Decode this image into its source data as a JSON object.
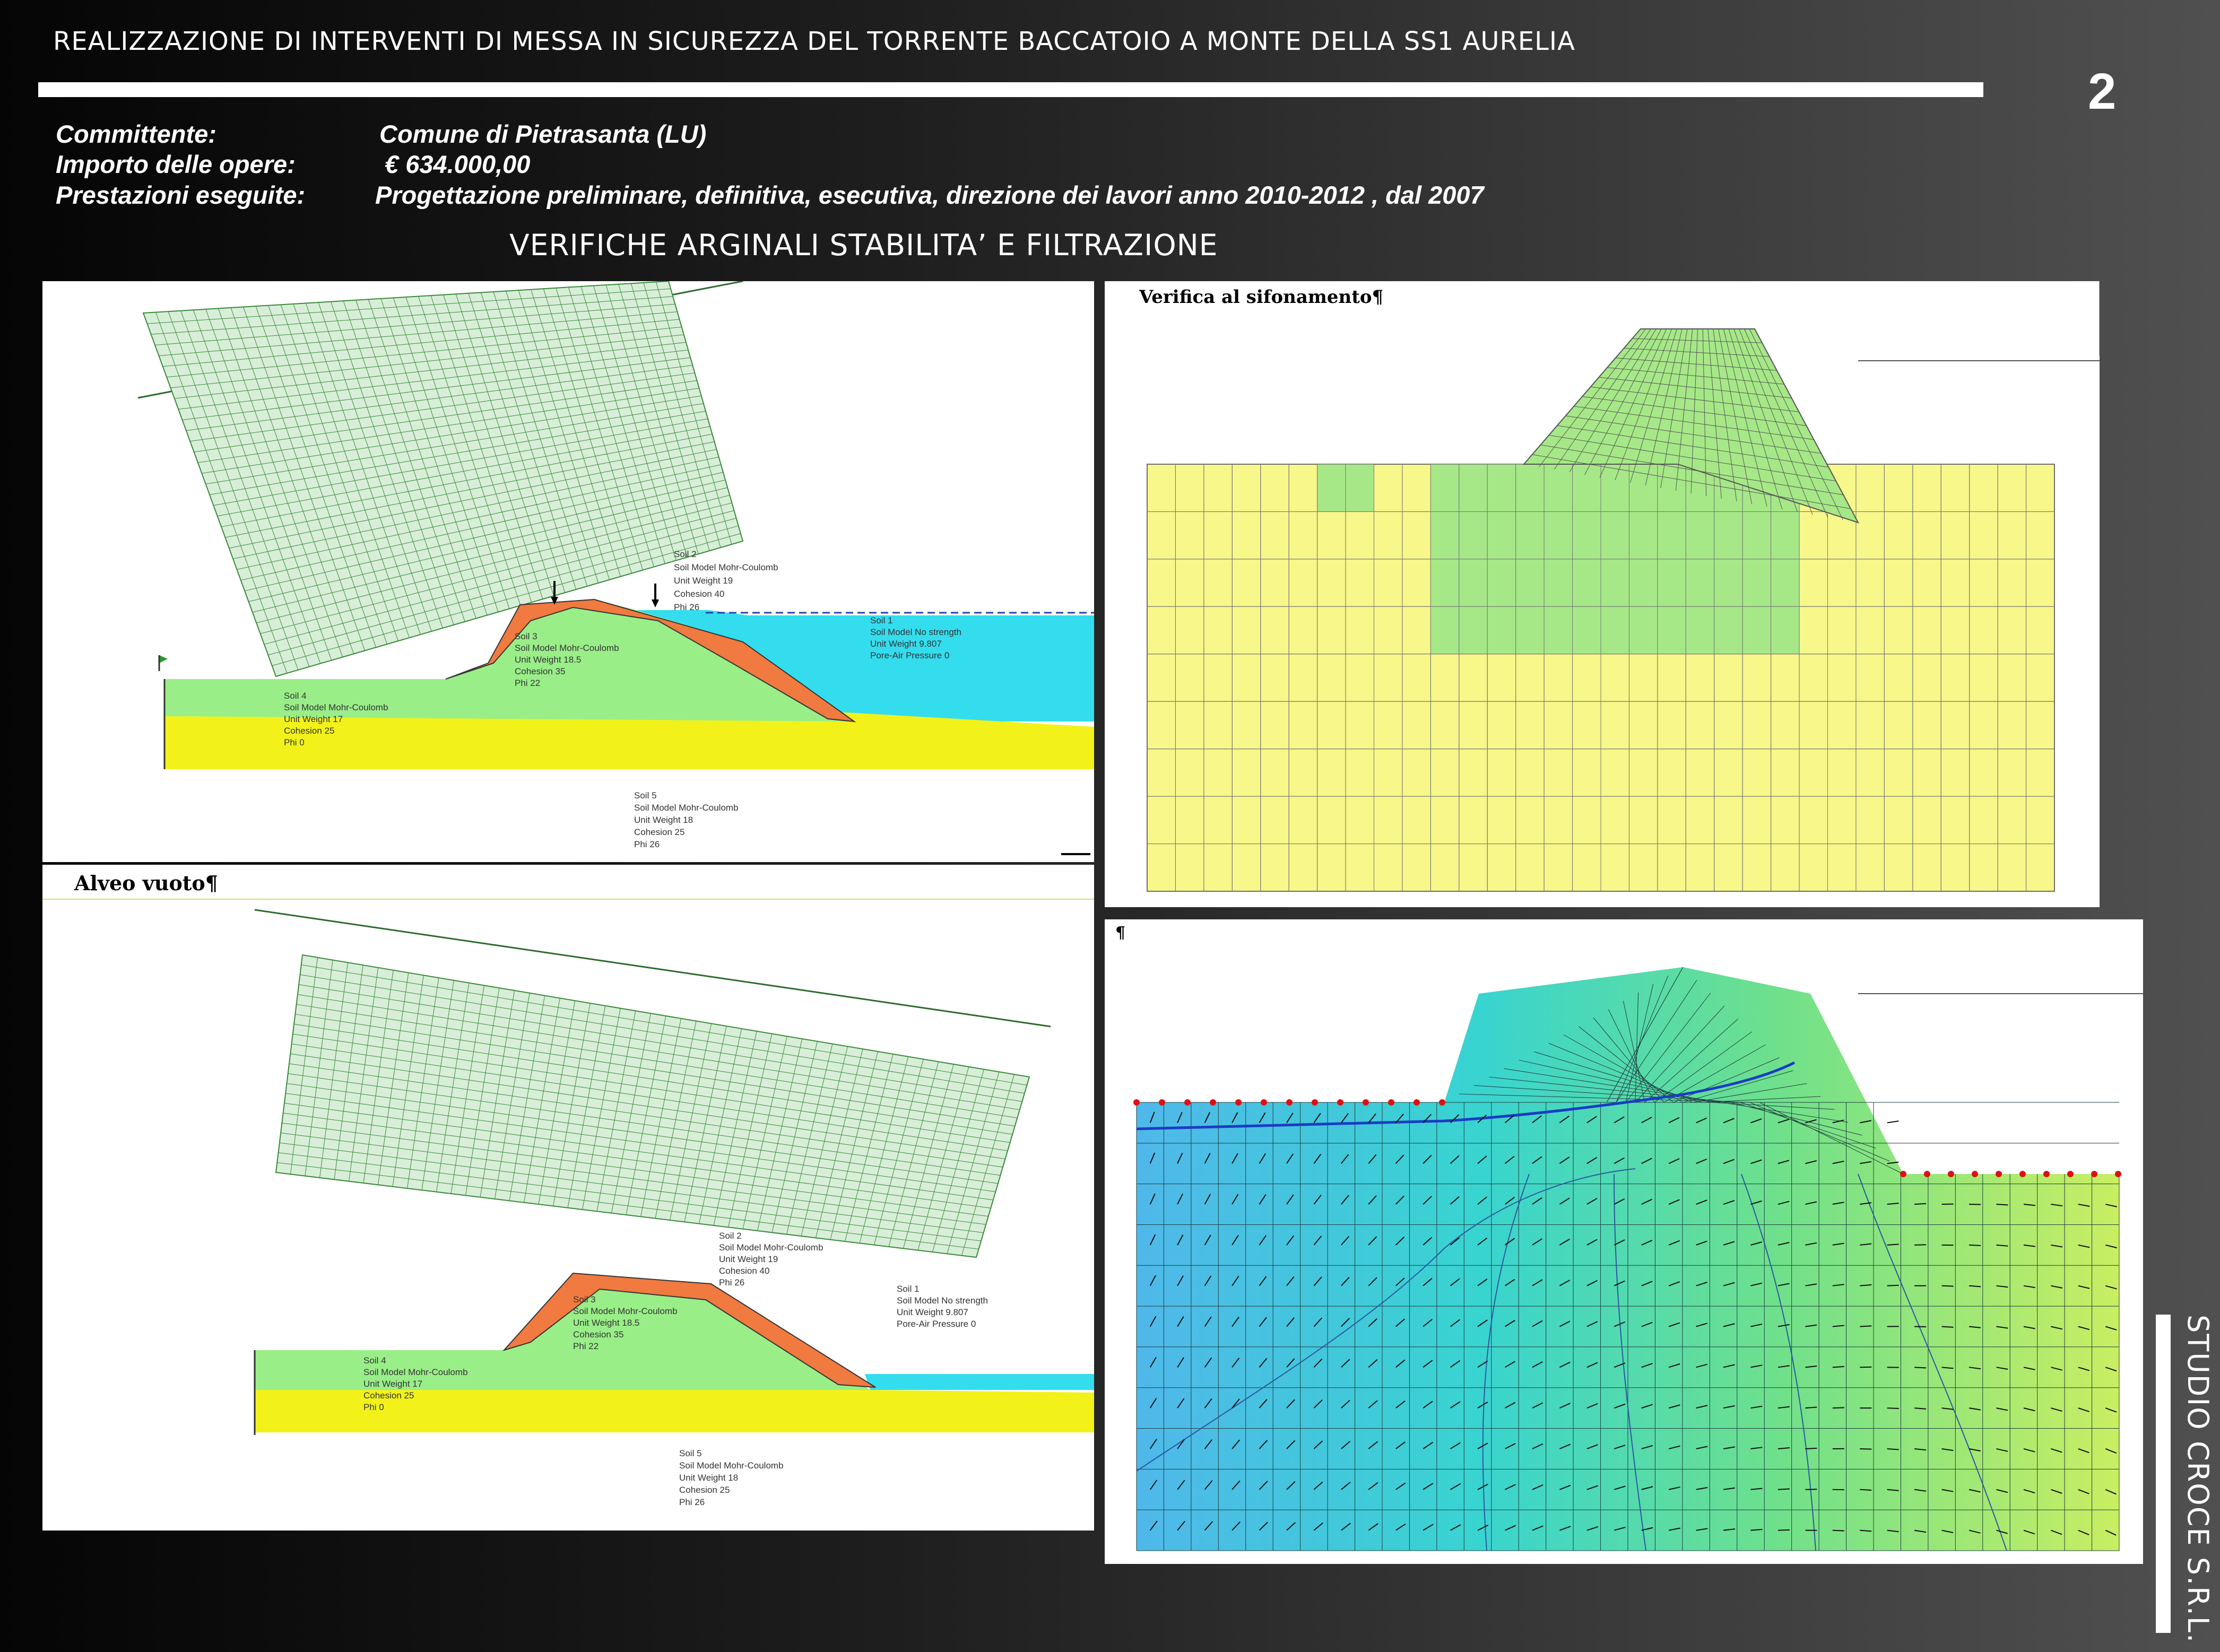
{
  "header": {
    "title": "REALIZZAZIONE DI INTERVENTI DI MESSA IN SICUREZZA DEL TORRENTE BACCATOIO A MONTE DELLA SS1 AURELIA",
    "page_number": "2"
  },
  "project": {
    "client_label": "Committente:",
    "client_value": "Comune di Pietrasanta (LU)",
    "amount_label": "Importo delle opere:",
    "amount_value": "€ 634.000,00",
    "services_label": "Prestazioni eseguite:",
    "services_value": "Progettazione  preliminare, definitiva, esecutiva, direzione dei lavori anno 2010-2012 , dal 2007"
  },
  "section_title": "VERIFICHE ARGINALI STABILITA’ E FILTRAZIONE",
  "panels": {
    "stability_full": {
      "soil2": [
        "Soil 2",
        "Soil Model Mohr-Coulomb",
        "Unit Weight 19",
        "Cohesion 40",
        "Phi 26"
      ],
      "soil3": [
        "Soil 3",
        "Soil Model Mohr-Coulomb",
        "Unit Weight 18.5",
        "Cohesion 35",
        "Phi 22"
      ],
      "soil1": [
        "Soil 1",
        "Soil Model No strength",
        "Unit Weight 9.807",
        "Pore-Air Pressure 0"
      ],
      "soil4": [
        "Soil 4",
        "Soil Model Mohr-Coulomb",
        "Unit Weight 17",
        "Cohesion 25",
        "Phi 0"
      ],
      "soil5": [
        "Soil 5",
        "Soil Model Mohr-Coulomb",
        "Unit Weight 18",
        "Cohesion 25",
        "Phi 26"
      ]
    },
    "stability_empty": {
      "title": "Alveo vuoto¶",
      "soil2": [
        "Soil 2",
        "Soil Model Mohr-Coulomb",
        "Unit Weight 19",
        "Cohesion 40",
        "Phi 26"
      ],
      "soil3": [
        "Soil 3",
        "Soil Model Mohr-Coulomb",
        "Unit Weight 18.5",
        "Cohesion 35",
        "Phi 22"
      ],
      "soil1": [
        "Soil 1",
        "Soil Model No strength",
        "Unit Weight 9.807",
        "Pore-Air Pressure 0"
      ],
      "soil4": [
        "Soil 4",
        "Soil Model Mohr-Coulomb",
        "Unit Weight 17",
        "Cohesion 25",
        "Phi 0"
      ],
      "soil5": [
        "Soil 5",
        "Soil Model Mohr-Coulomb",
        "Unit Weight 18",
        "Cohesion 25",
        "Phi 26"
      ]
    },
    "seepage_mesh": {
      "title": "Verifica al sifonamento¶"
    },
    "seepage_flow": {
      "title": "¶"
    }
  },
  "brand": "STUDIO CROCE S.R.L.",
  "colors": {
    "water": "#33ddee",
    "soil_embankment": "#f07a40",
    "soil_foundation_green": "#99ee88",
    "soil_base_yellow": "#f2f21a",
    "mesh_yellow": "#f7f78a",
    "mesh_green": "#a6e887",
    "grid_green": "#3a8a3a"
  }
}
